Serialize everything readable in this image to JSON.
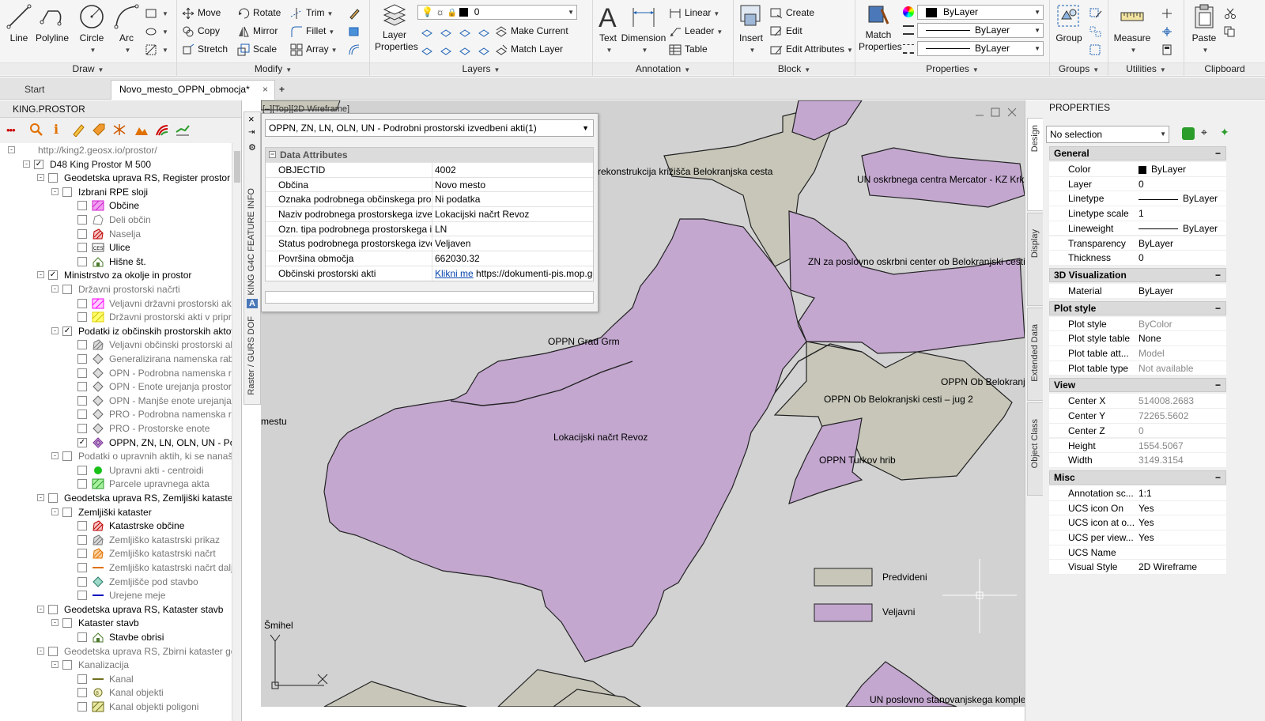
{
  "ribbon": {
    "draw": {
      "title": "Draw",
      "line": "Line",
      "polyline": "Polyline",
      "circle": "Circle",
      "arc": "Arc"
    },
    "modify": {
      "title": "Modify",
      "move": "Move",
      "rotate": "Rotate",
      "trim": "Trim",
      "copy": "Copy",
      "mirror": "Mirror",
      "fillet": "Fillet",
      "stretch": "Stretch",
      "scale": "Scale",
      "array": "Array"
    },
    "layers": {
      "title": "Layers",
      "layer_properties": "Layer Properties",
      "layer_combo": "0",
      "make_current": "Make Current",
      "match_layer": "Match Layer"
    },
    "annotation": {
      "title": "Annotation",
      "text": "Text",
      "dimension": "Dimension",
      "linear": "Linear",
      "leader": "Leader",
      "table": "Table"
    },
    "block": {
      "title": "Block",
      "insert": "Insert",
      "create": "Create",
      "edit": "Edit",
      "edit_attributes": "Edit Attributes"
    },
    "properties": {
      "title": "Properties",
      "match_properties": "Match Properties",
      "color": "ByLayer",
      "linetype": "ByLayer",
      "lineweight": "ByLayer"
    },
    "groups": {
      "title": "Groups",
      "group": "Group"
    },
    "utilities": {
      "title": "Utilities",
      "measure": "Measure"
    },
    "clipboard": {
      "title": "Clipboard",
      "paste": "Paste"
    }
  },
  "tabs": {
    "start": "Start",
    "doc": "Novo_mesto_OPPN_obmocja*"
  },
  "left": {
    "title": "KING.PROSTOR",
    "tree": [
      {
        "text": "http://king2.geosx.io/prostor/",
        "level": 0,
        "grey": true,
        "exp": "-"
      },
      {
        "text": "D48 King Prostor M 500",
        "level": 1,
        "exp": "-",
        "chk": "✓"
      },
      {
        "text": "Geodetska uprava RS, Register prostor",
        "level": 2,
        "exp": "-",
        "chk": "",
        "bold": true
      },
      {
        "text": "Izbrani RPE sloji",
        "level": 3,
        "exp": "-",
        "chk": "",
        "bold": true
      },
      {
        "text": "Občine",
        "level": 4,
        "chk": "",
        "icon": "hatch-magenta",
        "bold": true
      },
      {
        "text": "Deli občin",
        "level": 4,
        "chk": "",
        "icon": "outline-grey",
        "grey": true
      },
      {
        "text": "Naselja",
        "level": 4,
        "chk": "",
        "icon": "hatch-red",
        "grey": true
      },
      {
        "text": "Ulice",
        "level": 4,
        "chk": "",
        "icon": "cest",
        "bold": true
      },
      {
        "text": "Hišne št.",
        "level": 4,
        "chk": "",
        "icon": "house",
        "bold": true
      },
      {
        "text": "Ministrstvo za okolje in prostor",
        "level": 2,
        "exp": "-",
        "chk": "✓",
        "bold": true
      },
      {
        "text": "Državni prostorski načrti",
        "level": 3,
        "exp": "-",
        "chk": "",
        "grey": true
      },
      {
        "text": "Veljavni državni prostorski akti",
        "level": 4,
        "chk": "",
        "icon": "hatch-pink",
        "grey": true
      },
      {
        "text": "Državni prostorski akti v pripravi",
        "level": 4,
        "chk": "",
        "icon": "hatch-yellow",
        "grey": true
      },
      {
        "text": "Podatki iz občinskih prostorskih aktov",
        "level": 3,
        "exp": "-",
        "chk": "✓",
        "bold": true
      },
      {
        "text": "Veljavni občinski prostorski akti",
        "level": 4,
        "chk": "",
        "icon": "hatch-grey",
        "grey": true
      },
      {
        "text": "Generalizirana namenska raba",
        "level": 4,
        "chk": "",
        "icon": "poly-grey",
        "grey": true
      },
      {
        "text": "OPN - Podrobna namenska raba",
        "level": 4,
        "chk": "",
        "icon": "poly-grey",
        "grey": true
      },
      {
        "text": "OPN - Enote urejanja prostora",
        "level": 4,
        "chk": "",
        "icon": "poly-grey",
        "grey": true
      },
      {
        "text": "OPN - Manjše enote urejanja",
        "level": 4,
        "chk": "",
        "icon": "poly-grey",
        "grey": true
      },
      {
        "text": "PRO - Podrobna namenska raba",
        "level": 4,
        "chk": "",
        "icon": "poly-grey",
        "grey": true
      },
      {
        "text": "PRO - Prostorske enote",
        "level": 4,
        "chk": "",
        "icon": "poly-grey",
        "grey": true
      },
      {
        "text": "OPPN, ZN, LN, OLN, UN - Podrobni",
        "level": 4,
        "chk": "✓",
        "icon": "poly-purple",
        "bold": true
      },
      {
        "text": "Podatki o upravnih aktih, ki se nanašajo",
        "level": 3,
        "exp": "-",
        "chk": "",
        "grey": true
      },
      {
        "text": "Upravni akti - centroidi",
        "level": 4,
        "chk": "",
        "icon": "dot-green",
        "grey": true
      },
      {
        "text": "Parcele upravnega akta",
        "level": 4,
        "chk": "",
        "icon": "hatch-green",
        "grey": true
      },
      {
        "text": "Geodetska uprava RS, Zemljiški kataster",
        "level": 2,
        "exp": "-",
        "chk": "",
        "bold": true
      },
      {
        "text": "Zemljiški kataster",
        "level": 3,
        "exp": "-",
        "chk": "",
        "bold": true
      },
      {
        "text": "Katastrske občine",
        "level": 4,
        "chk": "",
        "icon": "hatch-red",
        "bold": true
      },
      {
        "text": "Zemljiško katastrski prikaz",
        "level": 4,
        "chk": "",
        "icon": "hatch-grey",
        "grey": true
      },
      {
        "text": "Zemljiško katastrski načrt",
        "level": 4,
        "chk": "",
        "icon": "hatch-orange",
        "grey": true
      },
      {
        "text": "Zemljiško katastrski načrt dalje",
        "level": 4,
        "chk": "",
        "icon": "line-orange",
        "grey": true
      },
      {
        "text": "Zemljišče pod stavbo",
        "level": 4,
        "chk": "",
        "icon": "hatch-teal",
        "grey": true
      },
      {
        "text": "Urejene meje",
        "level": 4,
        "chk": "",
        "icon": "line-blue",
        "grey": true
      },
      {
        "text": "Geodetska uprava RS, Kataster stavb",
        "level": 2,
        "exp": "-",
        "chk": "",
        "bold": true
      },
      {
        "text": "Kataster stavb",
        "level": 3,
        "exp": "-",
        "chk": "",
        "bold": true
      },
      {
        "text": "Stavbe obrisi",
        "level": 4,
        "chk": "",
        "icon": "house",
        "bold": true
      },
      {
        "text": "Geodetska uprava RS, Zbirni kataster go",
        "level": 2,
        "exp": "-",
        "chk": "",
        "grey": true
      },
      {
        "text": "Kanalizacija",
        "level": 3,
        "exp": "-",
        "chk": "",
        "grey": true
      },
      {
        "text": "Kanal",
        "level": 4,
        "chk": "",
        "icon": "line-olive",
        "grey": true
      },
      {
        "text": "Kanal objekti",
        "level": 4,
        "chk": "",
        "icon": "circle-olive",
        "grey": true
      },
      {
        "text": "Kanal objekti poligoni",
        "level": 4,
        "chk": "",
        "icon": "hatch-olive",
        "grey": true
      }
    ]
  },
  "sidebar": {
    "feature_info": "KING G4C FEATURE INFO",
    "raster": "Raster / GURS DOF"
  },
  "popup": {
    "layer": "OPPN, ZN, LN, OLN, UN - Podrobni prostorski izvedbeni akti(1)",
    "section": "Data Attributes",
    "rows": [
      {
        "k": "OBJECTID",
        "v": "4002"
      },
      {
        "k": "Občina",
        "v": "Novo mesto"
      },
      {
        "k": "Oznaka podrobnega občinskega prost",
        "v": "Ni podatka"
      },
      {
        "k": "Naziv podrobnega prostorskega izved",
        "v": "Lokacijski načrt Revoz"
      },
      {
        "k": "Ozn. tipa podrobnega prostorskega iz",
        "v": "LN"
      },
      {
        "k": "Status podrobnega prostorskega izve",
        "v": "Veljaven"
      },
      {
        "k": "Površina območja",
        "v": "662030.32"
      },
      {
        "k": "Občinski prostorski akti",
        "v": "https://dokumenti-pis.mop.gov.si",
        "link": "Klikni me"
      }
    ]
  },
  "drawing": {
    "viewport_label": "[–][Top][2D Wireframe]",
    "labels": {
      "belokranjska": "rekonstrukcija križišča Belokranjska cesta",
      "mercator": "UN oskrbnega centra Mercator - KZ Krka",
      "zn": "ZN za poslovno oskrbni center ob Belokranjski cesti",
      "gradgrm": "OPPN Grad Grm",
      "belokranj": "OPPN Ob Belokranjski",
      "jug2": "OPPN Ob Belokranjski cesti – jug 2",
      "revoz": "Lokacijski načrt Revoz",
      "turkov": "OPPN Turkov hrib",
      "mestu": "mestu",
      "smihel": "Šmihel",
      "stanov": "UN poslovno stanovanjskega kompleksa"
    },
    "legend": {
      "predvideni": "Predvideni",
      "veljavni": "Veljavni"
    },
    "colors": {
      "veljavni": "#c3a7cf",
      "predvideni": "#c7c6b9",
      "background": "#d2d2d2"
    }
  },
  "right": {
    "title": "PROPERTIES",
    "selection": "No selection",
    "vtabs": [
      "Design",
      "Display",
      "Extended Data",
      "Object Class"
    ],
    "sections": [
      {
        "title": "General",
        "rows": [
          {
            "k": "Color",
            "v": "ByLayer",
            "swatch": true
          },
          {
            "k": "Layer",
            "v": "0"
          },
          {
            "k": "Linetype",
            "v": "ByLayer",
            "line": true
          },
          {
            "k": "Linetype scale",
            "v": "1"
          },
          {
            "k": "Lineweight",
            "v": "ByLayer",
            "line": true
          },
          {
            "k": "Transparency",
            "v": "ByLayer"
          },
          {
            "k": "Thickness",
            "v": "0"
          }
        ]
      },
      {
        "title": "3D Visualization",
        "rows": [
          {
            "k": "Material",
            "v": "ByLayer"
          }
        ]
      },
      {
        "title": "Plot style",
        "rows": [
          {
            "k": "Plot style",
            "v": "ByColor",
            "grey": true
          },
          {
            "k": "Plot style table",
            "v": "None"
          },
          {
            "k": "Plot table att...",
            "v": "Model",
            "grey": true
          },
          {
            "k": "Plot table type",
            "v": "Not available",
            "grey": true
          }
        ]
      },
      {
        "title": "View",
        "rows": [
          {
            "k": "Center X",
            "v": "514008.2683",
            "grey": true
          },
          {
            "k": "Center Y",
            "v": "72265.5602",
            "grey": true
          },
          {
            "k": "Center Z",
            "v": "0",
            "grey": true
          },
          {
            "k": "Height",
            "v": "1554.5067",
            "grey": true
          },
          {
            "k": "Width",
            "v": "3149.3154",
            "grey": true
          }
        ]
      },
      {
        "title": "Misc",
        "rows": [
          {
            "k": "Annotation sc...",
            "v": "1:1"
          },
          {
            "k": "UCS icon On",
            "v": "Yes"
          },
          {
            "k": "UCS icon at o...",
            "v": "Yes"
          },
          {
            "k": "UCS per view...",
            "v": "Yes"
          },
          {
            "k": "UCS Name",
            "v": ""
          },
          {
            "k": "Visual Style",
            "v": "2D Wireframe"
          }
        ]
      }
    ]
  }
}
